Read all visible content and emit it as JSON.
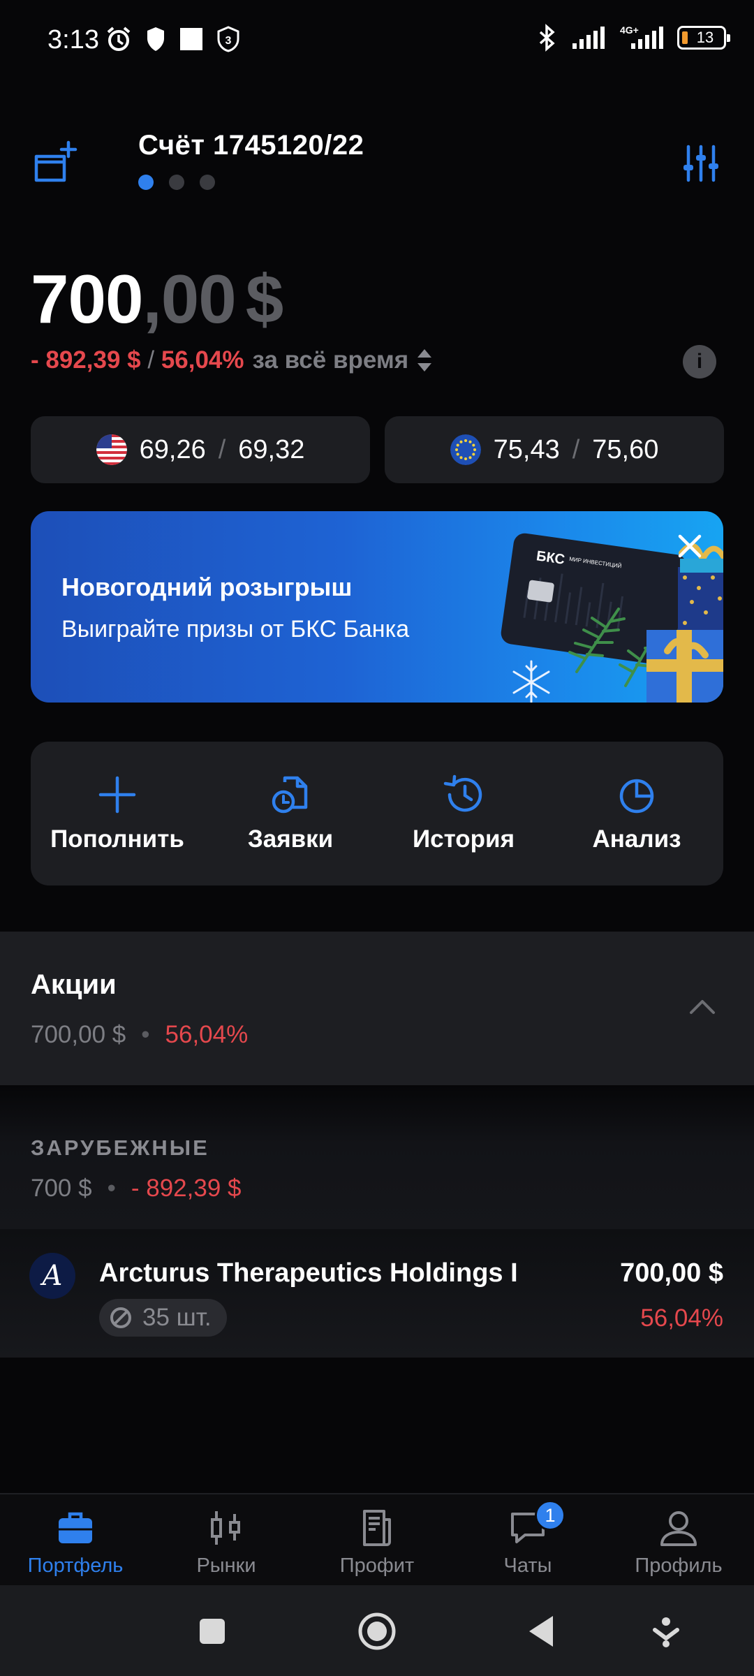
{
  "status_bar": {
    "time": "3:13",
    "battery": "13",
    "network": "4G+"
  },
  "header": {
    "account_title": "Счёт 1745120/22",
    "page_dots": 3,
    "active_dot": 0
  },
  "balance": {
    "integer": "700",
    "decimal": ",00",
    "currency": "$",
    "pl_amount": "- 892,39 $",
    "pl_sep": " / ",
    "pl_percent": "56,04%",
    "pl_period": "за всё время"
  },
  "rates": [
    {
      "flag": "us-flag-icon",
      "bid": "69,26",
      "sep": "/",
      "ask": "69,32"
    },
    {
      "flag": "eu-flag-icon",
      "bid": "75,43",
      "sep": "/",
      "ask": "75,60"
    }
  ],
  "promo": {
    "title": "Новогодний розыгрыш",
    "subtitle": "Выиграйте призы от БКС Банка",
    "card_brand": "БКС",
    "card_brand_sub": "МИР ИНВЕСТИЦИЙ"
  },
  "actions": [
    {
      "label": "Пополнить",
      "icon": "plus-icon"
    },
    {
      "label": "Заявки",
      "icon": "orders-icon"
    },
    {
      "label": "История",
      "icon": "history-icon"
    },
    {
      "label": "Анализ",
      "icon": "pie-chart-icon"
    }
  ],
  "stocks": {
    "title": "Акции",
    "amount": "700,00 $",
    "bullet": "•",
    "percent": "56,04%"
  },
  "foreign": {
    "title": "ЗАРУБЕЖНЫЕ",
    "amount": "700 $",
    "bullet": "•",
    "pl": "- 892,39 $"
  },
  "holding": {
    "logo_letter": "A",
    "name": "Arcturus Therapeutics Holdings I",
    "quantity": "35 шт.",
    "value": "700,00 $",
    "percent": "56,04%"
  },
  "tabs": [
    {
      "label": "Портфель",
      "icon": "briefcase-icon",
      "active": true
    },
    {
      "label": "Рынки",
      "icon": "candlestick-icon",
      "active": false
    },
    {
      "label": "Профит",
      "icon": "document-icon",
      "active": false
    },
    {
      "label": "Чаты",
      "icon": "chat-icon",
      "active": false,
      "badge": "1"
    },
    {
      "label": "Профиль",
      "icon": "person-icon",
      "active": false
    }
  ],
  "colors": {
    "accent": "#2f80ed",
    "negative": "#e5484d",
    "panel": "#1d1e22",
    "background": "#060608"
  }
}
